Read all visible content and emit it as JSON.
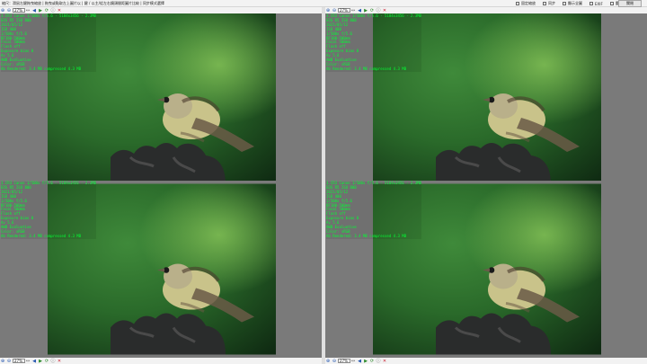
{
  "top": {
    "hint": "縮尺：滑鼠左鍵拖曳縮放 | 拖曳或點取左上圖片以 | 鍵 / 以主/從左右鏡頭間距圖片比較 | 同步模式選擇",
    "options": [
      {
        "label": "固定縮放"
      },
      {
        "label": "同步"
      },
      {
        "label": "顯示全圖"
      },
      {
        "label": "EXIF"
      },
      {
        "label": "重置"
      }
    ],
    "close_label": "關閉"
  },
  "panels": [
    {
      "id": "tl",
      "zoom": "27%",
      "overlay": [
        "3.CR3  Canon 1/500s f/5.6 · 5184x3456 · 2.3MB",
        "EOS R5  ISO 800",
        "2021/05/12",
        "ISO 400",
        "1/500s f/5.6",
        "RF100-500mm",
        "Focal 500mm",
        "Flash off",
        "Exposure bias 0",
        "Av 5.6",
        "AWB  Evaluative",
        "Color: sRGB",
        "Ab Rendered: 3.4 MB compressed  4.3 MB"
      ]
    },
    {
      "id": "tr",
      "zoom": "27%",
      "overlay": [
        "3.CR3  Canon 1/500s f/5.6 · 5184x3456 · 2.3MB",
        "EOS R5  ISO 800",
        "2021/05/12",
        "ISO 400",
        "1/500s f/5.6",
        "RF100-500mm",
        "Focal 500mm",
        "Flash off",
        "Exposure bias 0",
        "Av 5.6",
        "AWB  Evaluative",
        "Color: sRGB",
        "Ab Rendered: 3.4 MB compressed  4.3 MB"
      ]
    },
    {
      "id": "bl",
      "zoom": "27%",
      "overlay": [
        "3.CR3  Canon 1/500s f/5.6 · 5184x3456 · 2.3MB",
        "EOS R5  ISO 800",
        "2021/05/12",
        "ISO 400",
        "1/500s f/5.6",
        "RF100-500mm",
        "Focal 500mm",
        "Flash off",
        "Exposure bias 0",
        "Av 5.6",
        "AWB  Evaluative",
        "Color: sRGB",
        "Ab Rendered: 3.4 MB compressed  4.3 MB"
      ]
    },
    {
      "id": "br",
      "zoom": "27%",
      "overlay": [
        "3.CR3  Canon 1/500s f/5.6 · 5184x3456 · 2.3MB",
        "EOS R5  ISO 800",
        "2021/05/12",
        "ISO 400",
        "1/500s f/5.6",
        "RF100-500mm",
        "Focal 500mm",
        "Flash off",
        "Exposure bias 0",
        "Av 5.6",
        "AWB  Evaluative",
        "Color: sRGB",
        "Ab Rendered: 3.4 MB compressed  4.3 MB"
      ]
    }
  ],
  "icons": {
    "zoom_in": "zoom-in-icon",
    "zoom_out": "zoom-out-icon",
    "fit": "fit-icon",
    "prev": "prev-icon",
    "next": "next-icon",
    "rotate": "rotate-icon",
    "info": "info-icon",
    "close": "close-icon"
  },
  "colors": {
    "overlay_text": "#00ff33",
    "background_gray": "#7a7a7a"
  }
}
